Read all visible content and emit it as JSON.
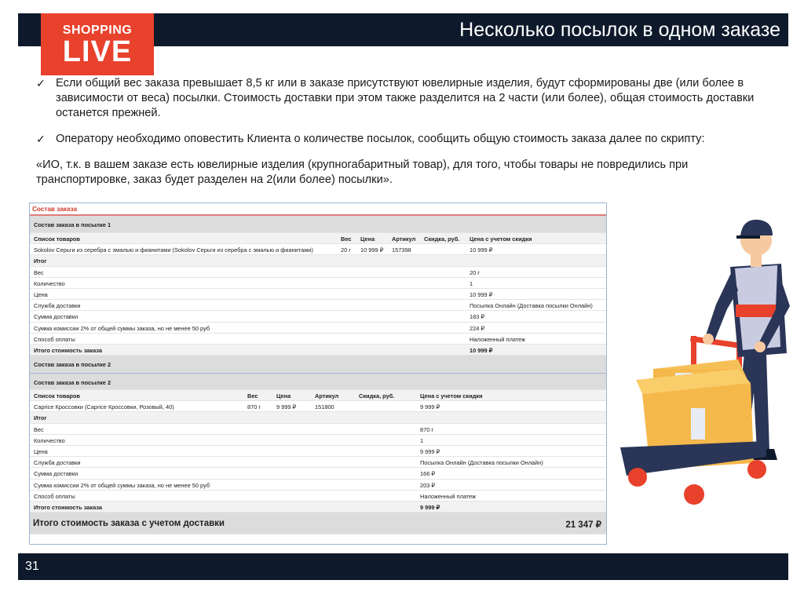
{
  "header": {
    "title": "Несколько посылок в одном заказе"
  },
  "logo": {
    "top": "SHOPPING",
    "bottom": "LIVE"
  },
  "bullets": [
    "Если общий вес заказа превышает 8,5 кг или в заказе присутствуют ювелирные изделия, будут сформированы две (или более в зависимости от веса) посылки. Стоимость доставки при этом также разделится на 2 части (или более), общая стоимость доставки останется прежней.",
    "Оператору необходимо оповестить Клиента о количестве посылок, сообщить общую стоимость заказа далее по скрипту:"
  ],
  "quote": "«ИО, т.к. в вашем заказе есть ювелирные изделия (крупногабаритный товар), для того, чтобы товары не повредились при транспортировке, заказ будет разделен на 2(или более) посылки».",
  "order": {
    "title": "Состав заказа",
    "parcel1": {
      "header": "Состав заказа в посылке 1",
      "columns": {
        "product": "Список товаров",
        "weight": "Вес",
        "price": "Цена",
        "article": "Артикул",
        "discount": "Скидка, руб.",
        "final": "Цена с учетом скидки"
      },
      "item": {
        "product": "Sokolov Серьги из серебра с эмалью и фианитами (Sokolov Серьги из серебра с эмалью и фианитами)",
        "weight": "20 г",
        "price": "10 999 ₽",
        "article": "157398",
        "discount": "",
        "final": "10 999 ₽"
      },
      "summary_label": "Итог",
      "rows": [
        {
          "label": "Вес",
          "value": "20 г"
        },
        {
          "label": "Количество",
          "value": "1"
        },
        {
          "label": "Цена",
          "value": "10 999 ₽"
        },
        {
          "label": "Служба доставки",
          "value": "Посылка Онлайн (Доставка посылки Онлайн)"
        },
        {
          "label": "Сумма доставки",
          "value": "183 ₽"
        },
        {
          "label": "Сумма комиссии 2% от общей суммы заказа, но не менее 50 руб",
          "value": "224 ₽"
        },
        {
          "label": "Способ оплаты",
          "value": "Наложенный платеж"
        }
      ],
      "total_label": "Итого стоимость заказа",
      "total_value": "10 999 ₽"
    },
    "parcel2_collapsed": "Состав заказа в посылке 2",
    "parcel2": {
      "header": "Состав заказа в посылке 2",
      "columns": {
        "product": "Список товаров",
        "weight": "Вес",
        "price": "Цена",
        "article": "Артикул",
        "discount": "Скидка, руб.",
        "final": "Цена с учетом скидки"
      },
      "item": {
        "product": "Caprice Кроссовки (Caprice Кроссовки, Розовый, 40)",
        "weight": "870 г",
        "price": "9 999 ₽",
        "article": "151800",
        "discount": "",
        "final": "9 999 ₽"
      },
      "summary_label": "Итог",
      "rows": [
        {
          "label": "Вес",
          "value": "870 г"
        },
        {
          "label": "Количество",
          "value": "1"
        },
        {
          "label": "Цена",
          "value": "9 999 ₽"
        },
        {
          "label": "Служба доставки",
          "value": "Посылка Онлайн (Доставка посылки Онлайн)"
        },
        {
          "label": "Сумма доставки",
          "value": "166 ₽"
        },
        {
          "label": "Сумма комиссии 2% от общей суммы заказа, но не менее 50 руб",
          "value": "203 ₽"
        },
        {
          "label": "Способ оплаты",
          "value": "Наложенный платеж"
        }
      ],
      "total_label": "Итого стоимость заказа",
      "total_value": "9 999 ₽"
    },
    "grand_total_label": "Итого стоимость заказа с учетом доставки",
    "grand_total_value": "21 347 ₽"
  },
  "footer": {
    "page": "31"
  },
  "colors": {
    "navy": "#0e1a2b",
    "logo_red": "#e8412c",
    "accent_red": "#d0392b"
  }
}
